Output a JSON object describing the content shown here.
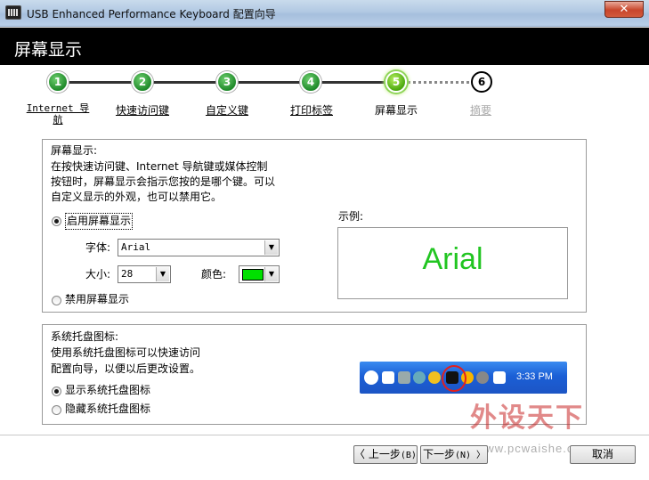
{
  "window": {
    "title": "USB Enhanced Performance Keyboard 配置向导",
    "close_label": "✕"
  },
  "header": {
    "title": "屏幕显示"
  },
  "steps": [
    {
      "number": "1",
      "label": "Internet 导航",
      "state": "done"
    },
    {
      "number": "2",
      "label": "快速访问键",
      "state": "done"
    },
    {
      "number": "3",
      "label": "自定义键",
      "state": "done"
    },
    {
      "number": "4",
      "label": "打印标签",
      "state": "done"
    },
    {
      "number": "5",
      "label": "屏幕显示",
      "state": "current"
    },
    {
      "number": "6",
      "label": "摘要",
      "state": "todo"
    }
  ],
  "osd": {
    "heading": "屏幕显示:",
    "desc_line1": "在按快速访问键、Internet 导航键或媒体控制",
    "desc_line2": "按钮时，屏幕显示会指示您按的是哪个键。可以",
    "desc_line3": "自定义显示的外观，也可以禁用它。",
    "enable_label": "启用屏幕显示",
    "enable_checked": true,
    "font_label": "字体:",
    "font_value": "Arial",
    "size_label": "大小:",
    "size_value": "28",
    "color_label": "颜色:",
    "color_value": "#00e000",
    "disable_label": "禁用屏幕显示",
    "example_label": "示例:",
    "example_text": "Arial"
  },
  "tray": {
    "heading": "系统托盘图标:",
    "desc_line1": "使用系统托盘图标可以快速访问",
    "desc_line2": "配置向导，以便以后更改设置。",
    "show_label": "显示系统托盘图标",
    "show_checked": true,
    "hide_label": "隐藏系统托盘图标",
    "clock": "3:33 PM"
  },
  "buttons": {
    "back_label": "〈 上一步",
    "back_key": "(B)",
    "next_label": "下一步",
    "next_key": "(N) 〉",
    "cancel_label": "取消"
  },
  "watermark": {
    "text": "外设天下",
    "url": "www.pcwaishe.cn"
  }
}
